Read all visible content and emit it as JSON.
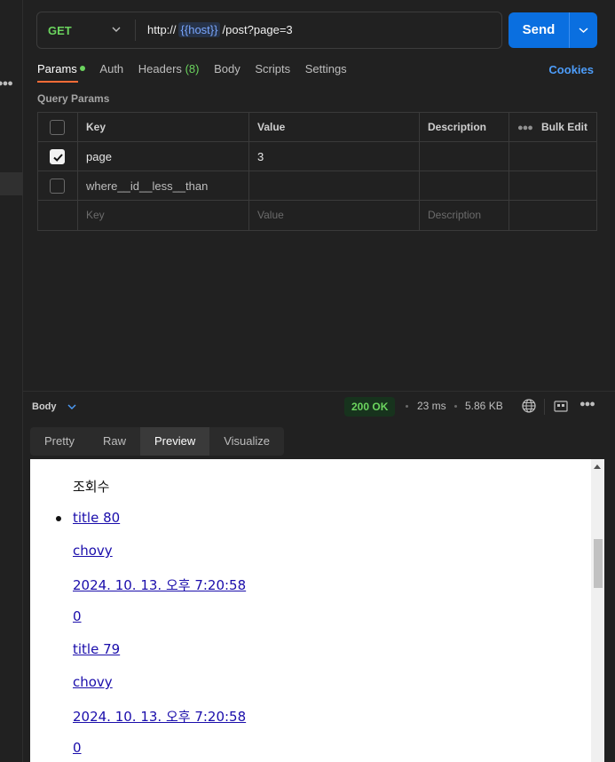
{
  "request": {
    "method": "GET",
    "url_prefix": "http://",
    "url_variable": "{{host}}",
    "url_suffix": "/post?page=3",
    "send_label": "Send"
  },
  "request_tabs": [
    {
      "label": "Params",
      "active": true,
      "has_dot": true
    },
    {
      "label": "Auth"
    },
    {
      "label": "Headers",
      "count": "(8)"
    },
    {
      "label": "Body"
    },
    {
      "label": "Scripts"
    },
    {
      "label": "Settings"
    }
  ],
  "cookies_label": "Cookies",
  "query_params": {
    "title": "Query Params",
    "headers": {
      "key": "Key",
      "value": "Value",
      "description": "Description",
      "bulk_edit": "Bulk Edit"
    },
    "rows": [
      {
        "checked": true,
        "key": "page",
        "value": "3",
        "description": ""
      },
      {
        "checked": false,
        "key": "where__id__less__than",
        "value": "",
        "description": ""
      }
    ],
    "placeholders": {
      "key": "Key",
      "value": "Value",
      "description": "Description"
    }
  },
  "response": {
    "body_label": "Body",
    "status": "200 OK",
    "time": "23 ms",
    "size": "5.86 KB",
    "view_tabs": [
      "Pretty",
      "Raw",
      "Preview",
      "Visualize"
    ],
    "active_view": "Preview",
    "preview": {
      "heading": "조회수",
      "items": [
        {
          "title": "title 80",
          "author": "chovy",
          "date": "2024. 10. 13. 오후 7:20:58",
          "views": "0"
        },
        {
          "title": "title 79",
          "author": "chovy",
          "date": "2024. 10. 13. 오후 7:20:58",
          "views": "0"
        }
      ]
    }
  },
  "colors": {
    "accent": "#0a6fe0",
    "method_green": "#6bd45e",
    "tab_underline": "#ff6c37",
    "link": "#1a0dab",
    "variable": "#7aa7ff"
  }
}
